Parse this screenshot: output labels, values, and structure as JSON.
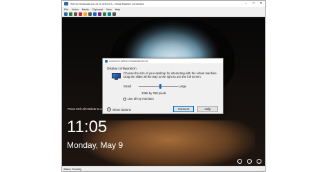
{
  "window": {
    "title": "W2K19-HostGuide-DC-01 on W2019-S - Virtual Machine Connection"
  },
  "menu": [
    "File",
    "Action",
    "Media",
    "Clipboard",
    "View",
    "Help"
  ],
  "toolbar": {
    "icons": [
      "ctrl-alt-del-icon",
      "start-icon",
      "turn-off-icon",
      "shutdown-icon",
      "save-icon",
      "pause-icon",
      "reset-icon",
      "checkpoint-icon",
      "revert-icon",
      "enhanced-session-icon",
      "share-icon"
    ],
    "colors": [
      "#2b6cb0",
      "#2e7d32",
      "#555555",
      "#c62828",
      "#f9a825",
      "#555555",
      "#1565c0",
      "#6a1b9a",
      "#2e7d32",
      "#00838f",
      "#555555"
    ]
  },
  "lockscreen": {
    "hint": "Press Ctrl+Alt+Delete to unlock",
    "time": "11:05",
    "date": "Monday, May 9"
  },
  "tray": {
    "icons": [
      "network-icon",
      "accessibility-icon",
      "power-icon"
    ]
  },
  "dialog": {
    "title": "Connect to W2K19-HostGuide-DC-01",
    "section": "Display configuration",
    "description": "Choose the size of your desktop for interacting with the virtual machine. Drag the slider all the way to the right to use the full screen.",
    "small_label": "Small",
    "large_label": "Large",
    "slider_fraction": 0.55,
    "resolution": "1366 by 768 pixels",
    "use_all_monitors": "Use all my monitors",
    "use_all_monitors_checked": false,
    "show_options": "Show Options",
    "connect": "Connect",
    "help": "Help"
  },
  "statusbar": {
    "status": "Status: Running"
  }
}
